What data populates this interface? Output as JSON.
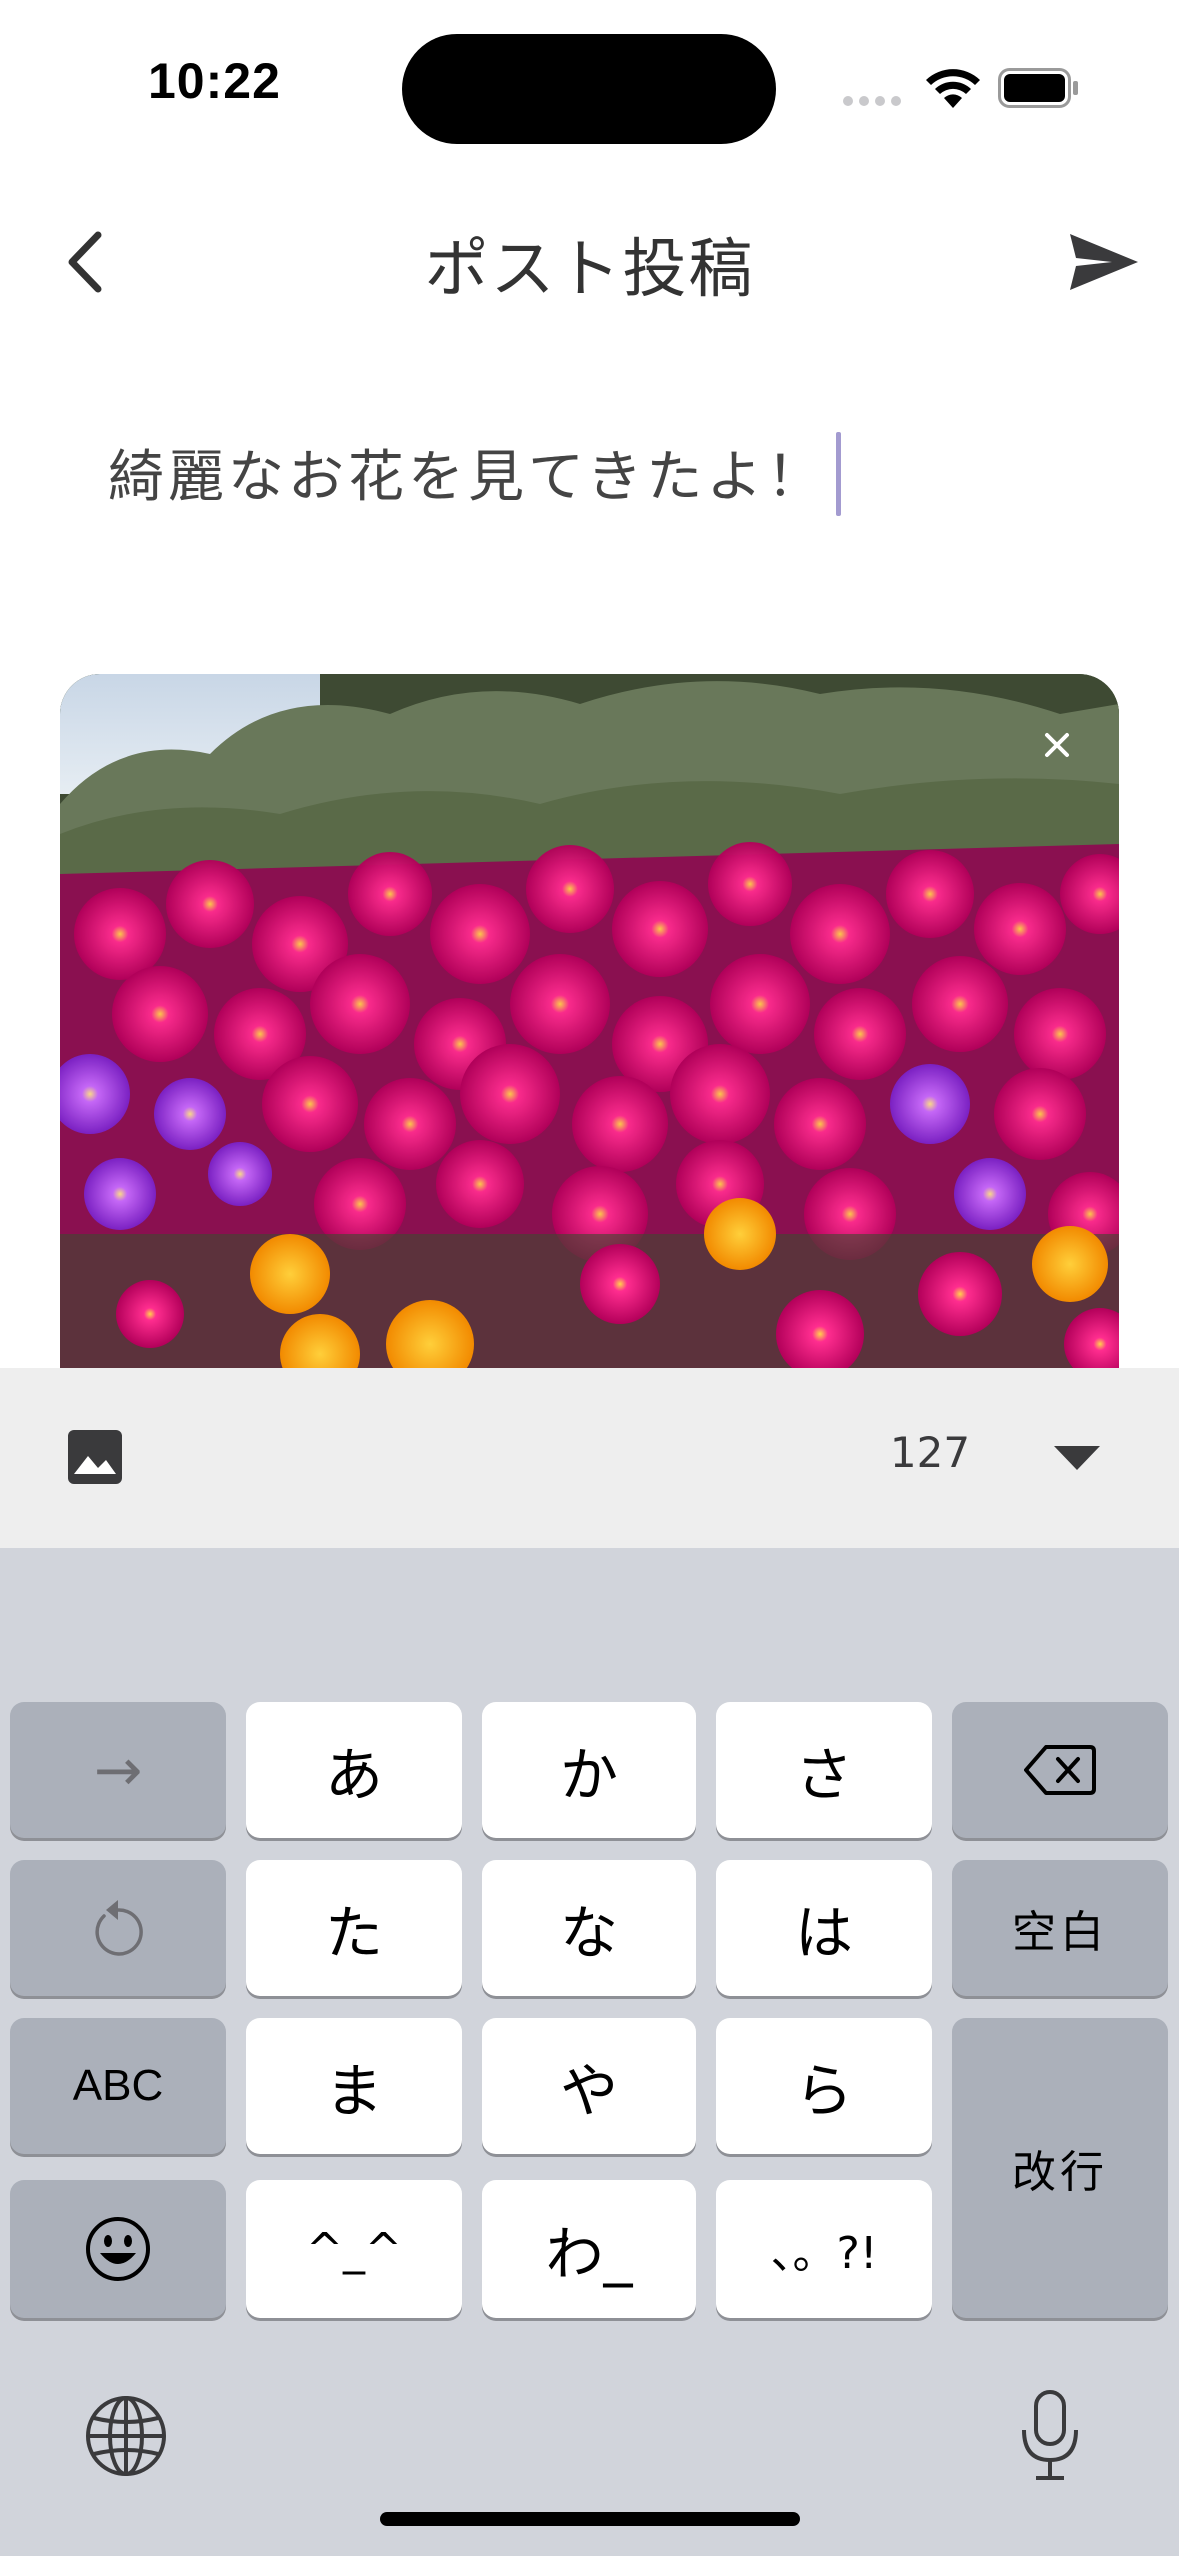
{
  "status_bar": {
    "time": "10:22"
  },
  "header": {
    "title": "ポスト投稿"
  },
  "post": {
    "text": "綺麗なお花を見てきたよ！"
  },
  "toolbar": {
    "char_count": "127"
  },
  "keyboard": {
    "keys": {
      "arrow": "→",
      "a": "あ",
      "ka": "か",
      "sa": "さ",
      "ta": "た",
      "na": "な",
      "ha": "は",
      "space": "空白",
      "abc": "ABC",
      "ma": "ま",
      "ya": "や",
      "ra": "ら",
      "enter": "改行",
      "kaomoji": "^_^",
      "wa": "わ_",
      "punct": "、。?!"
    }
  },
  "icons": {
    "back": "chevron-left-icon",
    "send": "send-icon",
    "close": "close-icon",
    "image": "image-icon",
    "collapse": "triangle-down-icon",
    "delete": "backspace-icon",
    "undo": "undo-icon",
    "emoji": "emoji-icon",
    "globe": "globe-icon",
    "mic": "microphone-icon"
  },
  "colors": {
    "cursor": "#a39bd0",
    "keyboard_bg": "#d1d4db",
    "toolbar_bg": "#eeeeee"
  }
}
